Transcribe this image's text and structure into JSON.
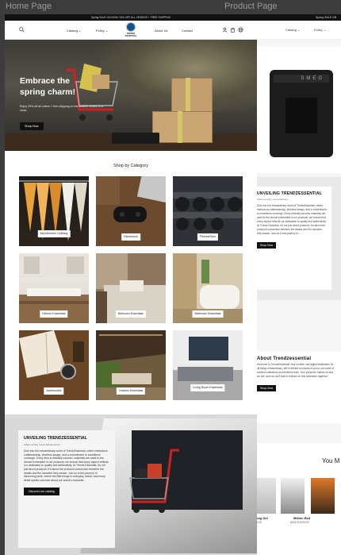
{
  "labels": {
    "home": "Home Page",
    "product": "Product Page"
  },
  "topbar": "Spring SALE ON NOW: 20% OFF ALL ORDERS + FREE SHIPPING",
  "header": {
    "menu": [
      "Catalog ⌄",
      "Policy ⌄",
      "About Us",
      "Contact"
    ],
    "logo_text": "TRENDZ ESSENTIAL"
  },
  "hero": {
    "title_line1": "Embrace the",
    "title_line2": "spring charm!",
    "text": "Enjoy 20% off all orders + free shipping on the season comes to a close.",
    "cta": "Shop Now"
  },
  "category_section": {
    "title": "Shop by Category",
    "tiles": [
      {
        "label": "Men/Women Clothing"
      },
      {
        "label": "Electronics"
      },
      {
        "label": "Fitness/Gym"
      },
      {
        "label": "Kitchen Essentials"
      },
      {
        "label": "Bedroom Essentials"
      },
      {
        "label": "Bathroom Essentials"
      },
      {
        "label": "Accessories"
      },
      {
        "label": "Outdoor Essentials"
      },
      {
        "label": "Living Room Essentials"
      }
    ]
  },
  "about": {
    "title": "UNVEILING TRENDZESSENTIAL",
    "subtitle": "Where quality meets fabulousness",
    "text": "Dive into the extraordinary world of TrendzEssential, where meticulous craftsmanship, timeless design, and a commitment to excellence converge. Every item is ethically sourced, materials are used to the utmost embedded in our products; we ensure that every aspect reflects our dedication to quality and authenticity. At Trendz Essential, it's not just about products; it's about the profound connection between the details and the narrative they weave. Join us in this journey of discerning taste, where the little things in everyday unfold, and every detail speaks volumes about our brand's character.",
    "cta": "Discover our catalog"
  },
  "product_page": {
    "topbar": "Spring SALE ON",
    "menu": [
      "Catalog ⌄",
      "Policy ⌄"
    ],
    "machine_brand": "SMEG",
    "section1_title": "UNVEILING TRENDZESSENTIAL",
    "section1_sub": "Where quality meets fabulous",
    "section1_text": "Dive into the extraordinary world of TrendzEssential, where meticulous craftsmanship, timeless design, and a commitment to excellence converge. Every ethically sourced materials are used to the utmost embedded in our products, we ensure that every aspect reflects our dedication to quality and authenticity. At Trendz Essential, it's not just about products; it's about the profound connection between the details and the narrative they weave. Join us in this journey of...",
    "section1_cta": "Shop Now",
    "section2_title": "About Trendzessential",
    "section2_text": "Welcome to TrendzEssential! Your number one digital destination for all things extraordinary. We're thrilled to introduce you to our world of curated collections and timeless finds. Your presence makes us who we are, and we can't wait to embark on this adventure together!",
    "section2_cta": "Shop Now",
    "section3_title": "You M",
    "products": [
      {
        "name": "Dining Set",
        "price": "$399.99"
      },
      {
        "name": "Million Bed",
        "price": "$449.99  $399.99"
      }
    ]
  }
}
